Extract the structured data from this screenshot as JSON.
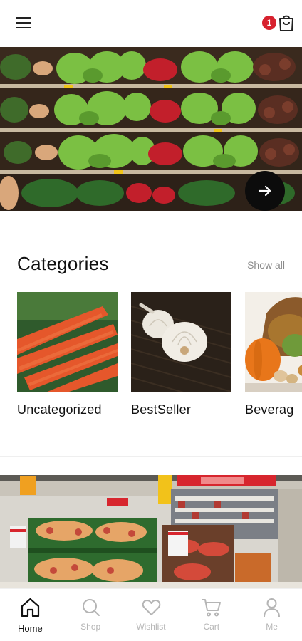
{
  "header": {
    "menu_icon": "hamburger-menu-icon",
    "cart_icon": "shopping-bag-icon",
    "cart_count": "1",
    "badge_color": "#d7212e"
  },
  "hero": {
    "image": "supermarket vegetable shelves",
    "next_icon": "arrow-right-icon",
    "slides_count": 3,
    "active_slide": 1
  },
  "categories": {
    "title": "Categories",
    "show_all": "Show all",
    "items": [
      {
        "label": "Uncategorized",
        "image": "carrots"
      },
      {
        "label": "BestSeller",
        "image": "garlic"
      },
      {
        "label": "Beverag",
        "image": "pumpkins"
      }
    ]
  },
  "promo": {
    "image": "supermarket aisle with produce crates"
  },
  "bottom_nav": {
    "active": "Home",
    "items": [
      {
        "label": "Home",
        "icon": "home-icon"
      },
      {
        "label": "Shop",
        "icon": "search-icon"
      },
      {
        "label": "Wishlist",
        "icon": "heart-icon"
      },
      {
        "label": "Cart",
        "icon": "cart-icon"
      },
      {
        "label": "Me",
        "icon": "user-icon"
      }
    ]
  }
}
